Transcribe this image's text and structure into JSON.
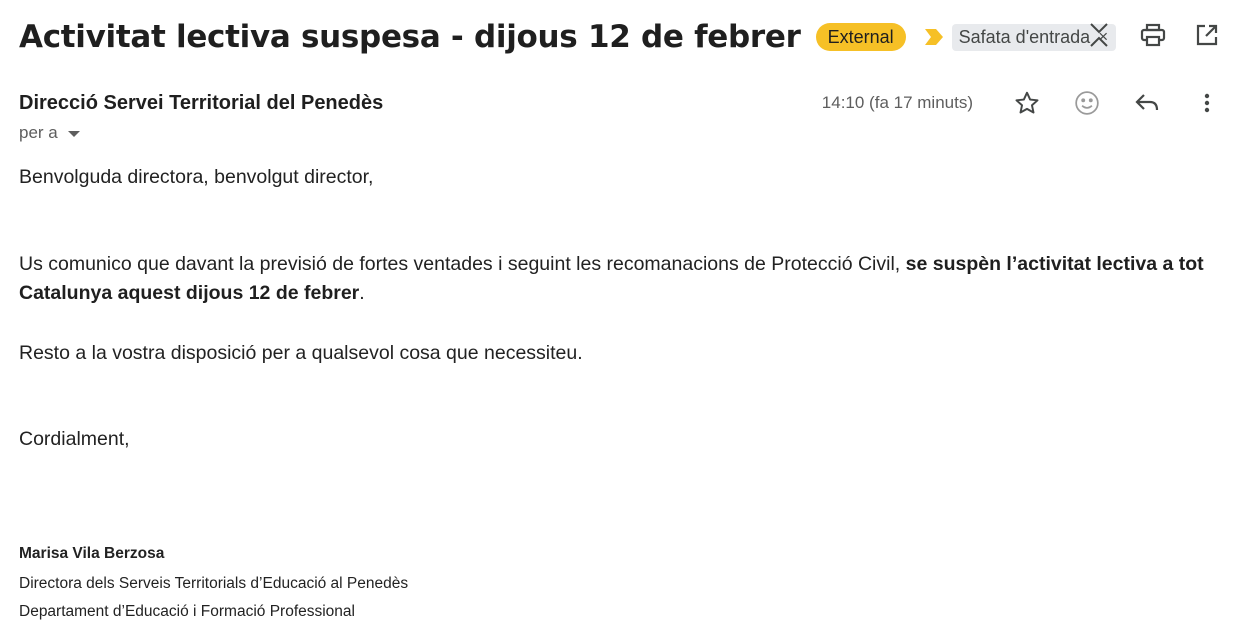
{
  "subject": "Activitat lectiva suspesa - dijous 12 de febrer",
  "labels": {
    "external": "External",
    "inbox": "Safata d'entrada",
    "inbox_remove": "×"
  },
  "sender": {
    "name": "Direcció Servei Territorial del Penedès",
    "time": "14:10 (fa 17 minuts)",
    "to": "per a"
  },
  "body": {
    "greeting": "Benvolguda directora, benvolgut director,",
    "main_plain": "Us comunico que davant la previsió de fortes ventades i seguint les recomanacions de Protecció Civil, ",
    "main_bold": "se suspèn l’activitat lectiva a tot Catalunya aquest dijous 12  de febrer",
    "main_end": ".",
    "resto": "Resto a la vostra disposició per a qualsevol cosa que necessiteu.",
    "closing": "Cordialment,"
  },
  "signature": {
    "name": "Marisa Vila Berzosa",
    "title": "Directora dels Serveis Territorials d’Educació al Penedès",
    "department": "Departament d’Educació i Formació Professional"
  },
  "colors": {
    "external_badge": "#f6c026",
    "inbox_chip": "#e8eaed",
    "importance_arrow": "#f6c026",
    "icon": "#444746"
  },
  "icons": [
    "collapse-icon",
    "print-icon",
    "open-in-new-window-icon",
    "star-icon",
    "emoji-icon",
    "reply-icon",
    "more-vert-icon",
    "importance-arrow-icon"
  ]
}
